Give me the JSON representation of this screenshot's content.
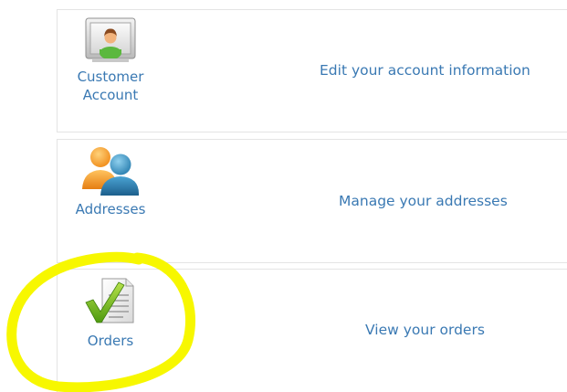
{
  "rows": [
    {
      "label_lines": [
        "Customer",
        "Account"
      ],
      "description": "Edit your account information",
      "icon": "customer-account-icon"
    },
    {
      "label_lines": [
        "Addresses"
      ],
      "description": "Manage your addresses",
      "icon": "addresses-icon"
    },
    {
      "label_lines": [
        "Orders"
      ],
      "description": "View your orders",
      "icon": "orders-icon"
    }
  ],
  "colors": {
    "link": "#3a79b3",
    "border": "#e4e4e4",
    "highlight": "#f7f700"
  }
}
